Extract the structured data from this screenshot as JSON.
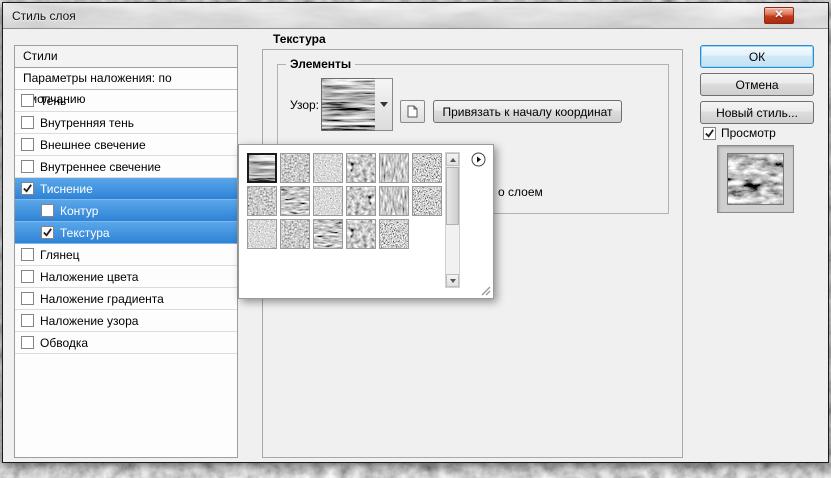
{
  "window": {
    "title": "Стиль слоя"
  },
  "sidebar": {
    "header": "Стили",
    "blending": "Параметры наложения: по умолчанию",
    "items": [
      {
        "label": "Тень",
        "checked": false,
        "selected": false
      },
      {
        "label": "Внутренняя тень",
        "checked": false,
        "selected": false
      },
      {
        "label": "Внешнее свечение",
        "checked": false,
        "selected": false
      },
      {
        "label": "Внутреннее свечение",
        "checked": false,
        "selected": false
      },
      {
        "label": "Тиснение",
        "checked": true,
        "selected": true
      },
      {
        "label": "Контур",
        "checked": false,
        "selected": true,
        "indent": true
      },
      {
        "label": "Текстура",
        "checked": true,
        "selected": true,
        "indent": true
      },
      {
        "label": "Глянец",
        "checked": false,
        "selected": false
      },
      {
        "label": "Наложение цвета",
        "checked": false,
        "selected": false
      },
      {
        "label": "Наложение градиента",
        "checked": false,
        "selected": false
      },
      {
        "label": "Наложение узора",
        "checked": false,
        "selected": false
      },
      {
        "label": "Обводка",
        "checked": false,
        "selected": false
      }
    ]
  },
  "texture_panel": {
    "title": "Текстура",
    "group": "Элементы",
    "pattern_label": "Узор:",
    "snap_button": "Привязать к началу координат",
    "link_with_layer_partial": "о слоем"
  },
  "pattern_picker": {
    "swatch_count": 17,
    "selected_index": 0
  },
  "actions": {
    "ok": "ОК",
    "cancel": "Отмена",
    "new_style": "Новый стиль...",
    "preview": "Просмотр",
    "preview_checked": true
  },
  "colors": {
    "selection_top": "#5aa7ea",
    "selection_bottom": "#2e82d6",
    "close_button_red": "#c53a1c",
    "dialog_bg": "#f0f0f0"
  }
}
